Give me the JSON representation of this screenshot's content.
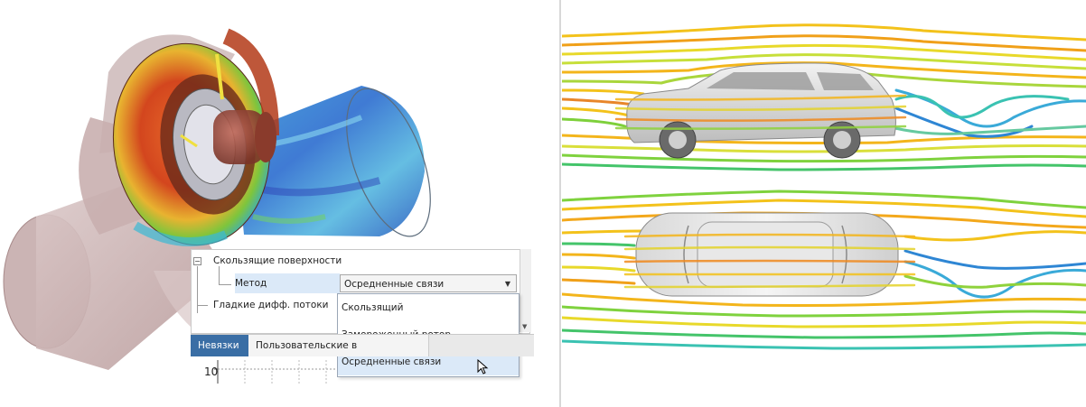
{
  "property_grid": {
    "group_label": "Скользящие поверхности",
    "method_label": "Метод",
    "method_value": "Осредненные связи",
    "smooth_flows_label": "Гладкие дифф. потоки"
  },
  "dropdown": {
    "options": [
      "Скользящий",
      "Замороженный ротор",
      "Осредненные связи"
    ],
    "selected_index": 2
  },
  "tabs": [
    {
      "label": "Невязки",
      "active": true
    },
    {
      "label": "Пользовательские в",
      "active": false
    }
  ],
  "chart_stub": {
    "y_tick": "10"
  },
  "icons": {
    "combo_arrow": "chevron-down-icon",
    "tree_expander": "minus-expander-icon",
    "cursor": "mouse-pointer-icon"
  },
  "colors": {
    "selection": "#dbe9f8",
    "active_tab": "#3a6ea5"
  }
}
